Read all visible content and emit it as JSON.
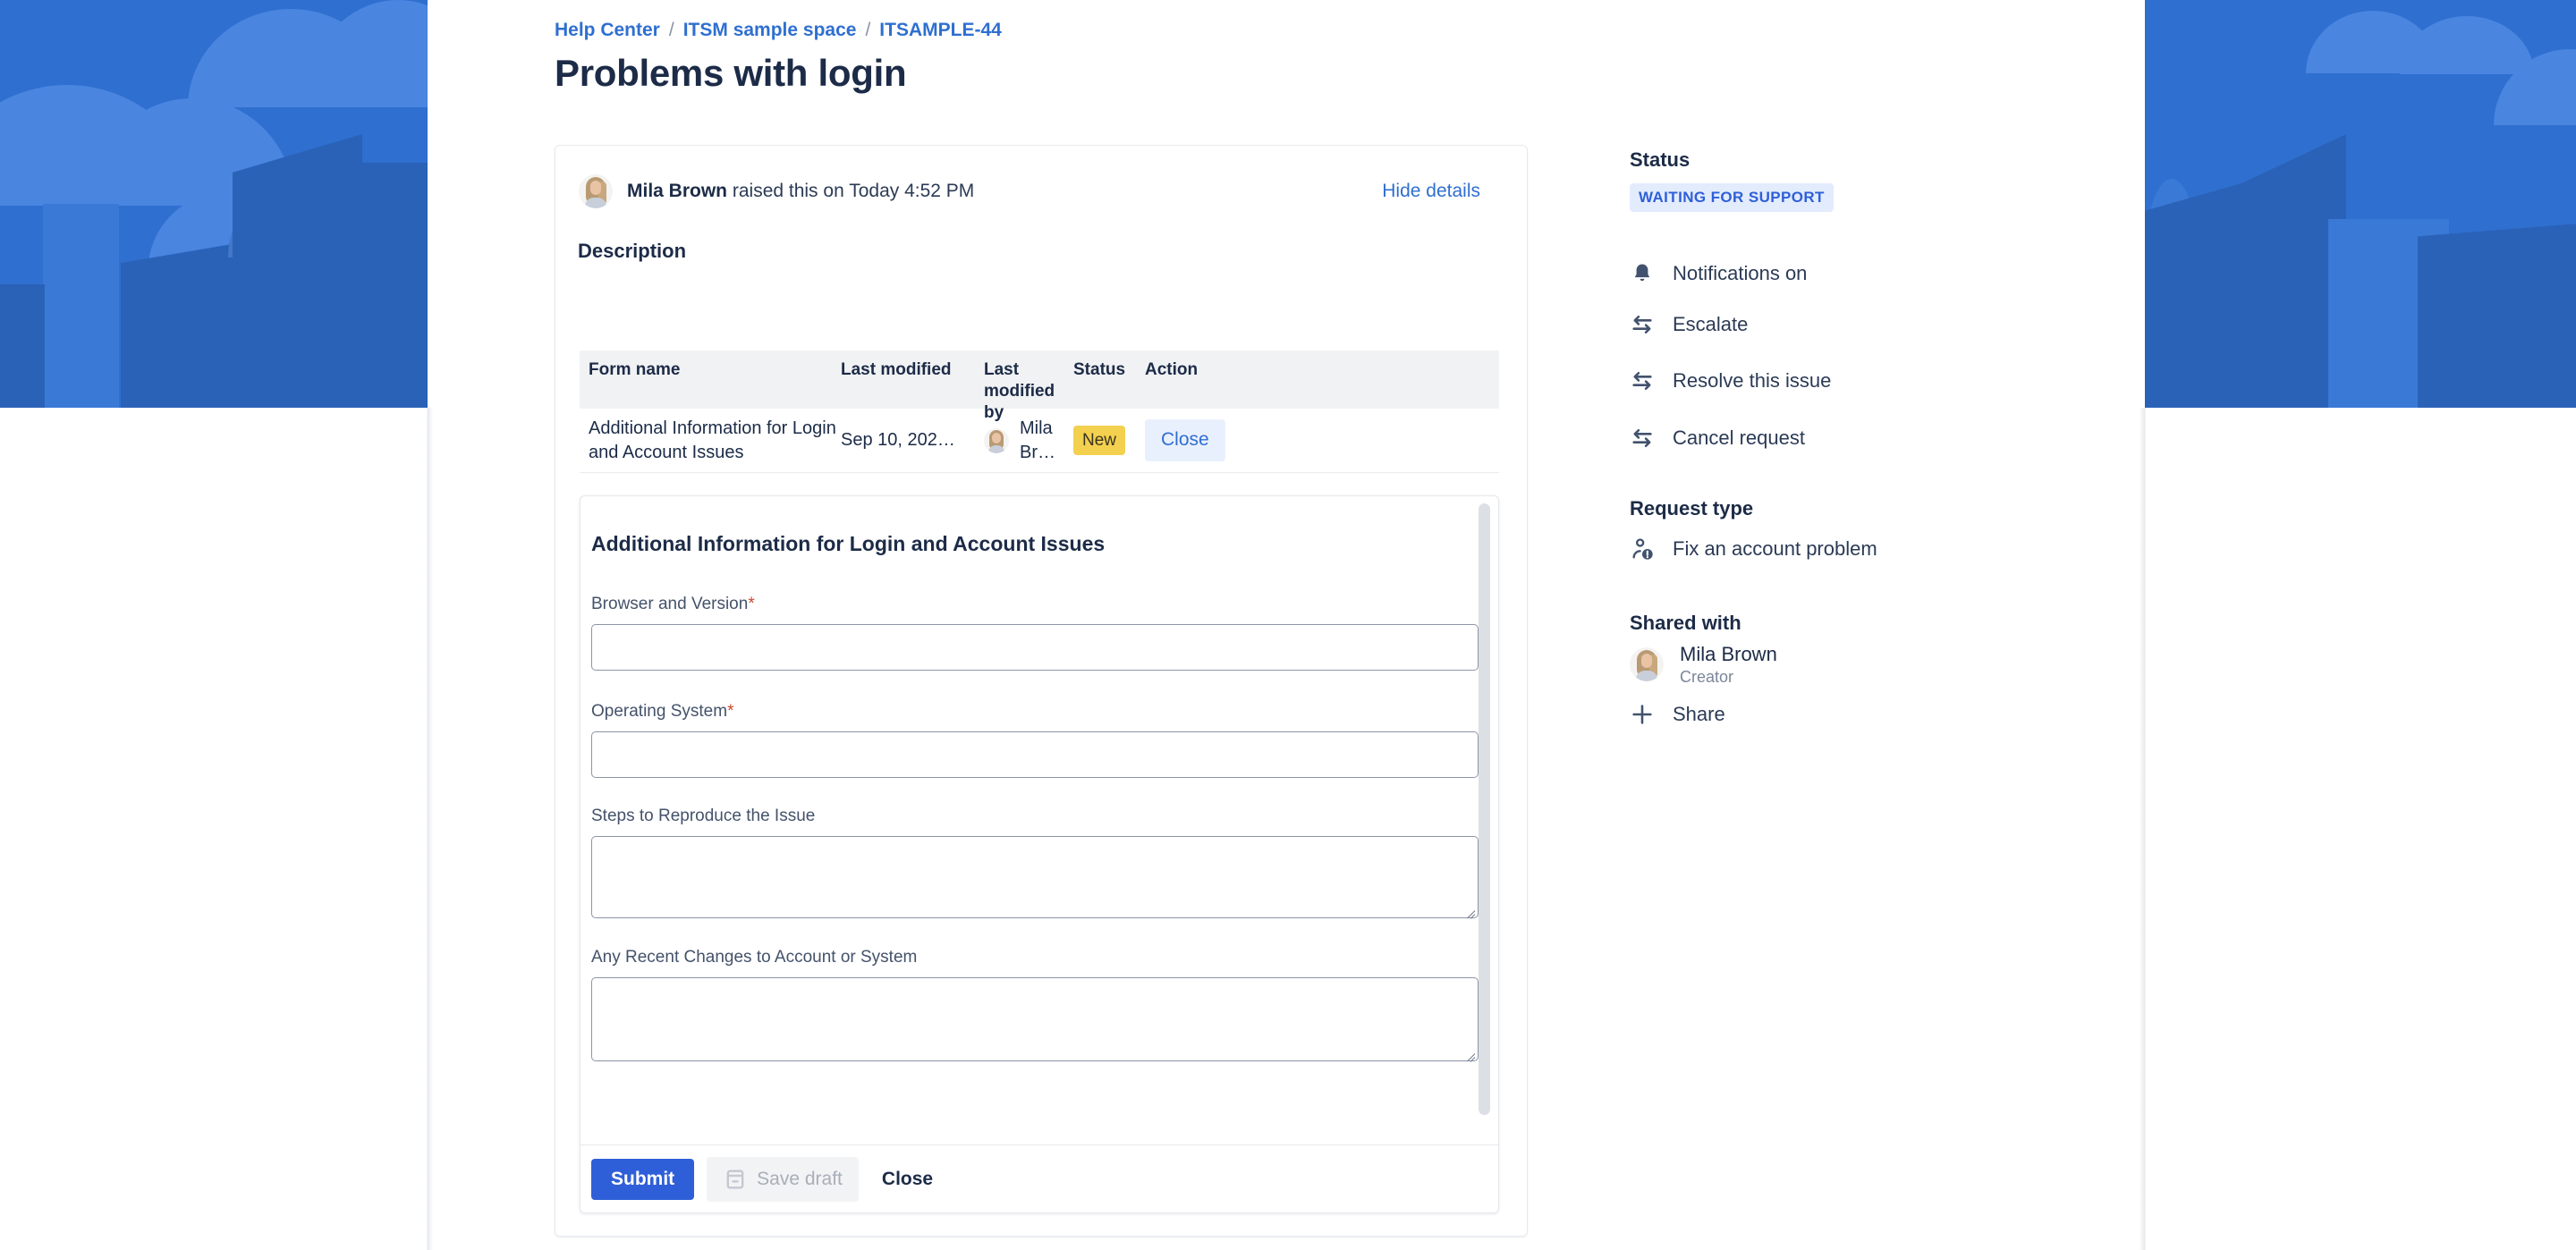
{
  "breadcrumb": [
    {
      "label": "Help Center"
    },
    {
      "label": "ITSM sample space"
    },
    {
      "label": "ITSAMPLE-44"
    }
  ],
  "breadcrumb_separator": "/",
  "page_title": "Problems with login",
  "request": {
    "reporter_name": "Mila Brown",
    "raised_text": " raised this on Today 4:52 PM",
    "hide_details": "Hide details",
    "description_label": "Description"
  },
  "forms_table": {
    "columns": [
      "Form name",
      "Last modified",
      "Last modified by",
      "Status",
      "Action"
    ],
    "rows": [
      {
        "form_name": "Additional Information for Login and Account Issues",
        "last_modified": "Sep 10, 202…",
        "last_modified_by": "Mila Br…",
        "status": "New",
        "action": "Close"
      }
    ]
  },
  "form_panel": {
    "title": "Additional Information for Login and Account Issues",
    "fields": [
      {
        "label": "Browser and Version",
        "required": true,
        "type": "text",
        "value": ""
      },
      {
        "label": "Operating System",
        "required": true,
        "type": "text",
        "value": ""
      },
      {
        "label": "Steps to Reproduce the Issue",
        "required": false,
        "type": "textarea",
        "value": ""
      },
      {
        "label": "Any Recent Changes to Account or System",
        "required": false,
        "type": "textarea",
        "value": ""
      }
    ],
    "required_marker": "*",
    "buttons": {
      "submit": "Submit",
      "save_draft": "Save draft",
      "close": "Close"
    }
  },
  "sidebar": {
    "status_heading": "Status",
    "status_value": "WAITING FOR SUPPORT",
    "actions": [
      {
        "label": "Notifications on",
        "icon": "bell-icon"
      },
      {
        "label": "Escalate",
        "icon": "transition-icon"
      },
      {
        "label": "Resolve this issue",
        "icon": "transition-icon"
      },
      {
        "label": "Cancel request",
        "icon": "transition-icon"
      }
    ],
    "request_type_heading": "Request type",
    "request_type_value": "Fix an account problem",
    "request_type_icon": "person-alert-icon",
    "shared_with_heading": "Shared with",
    "shared_people": [
      {
        "name": "Mila Brown",
        "role": "Creator"
      }
    ],
    "share_label": "Share",
    "share_icon": "plus-icon"
  },
  "colors": {
    "brand_blue": "#2f6fd0",
    "link_blue": "#2f6fd0",
    "submit_blue": "#2f5fd8",
    "status_badge_bg": "#e2ecfd",
    "status_badge_text": "#2f5fd8",
    "new_lozenge_bg": "#f3d04e",
    "required_star": "#c9482a",
    "text_dark": "#1c2b47"
  }
}
